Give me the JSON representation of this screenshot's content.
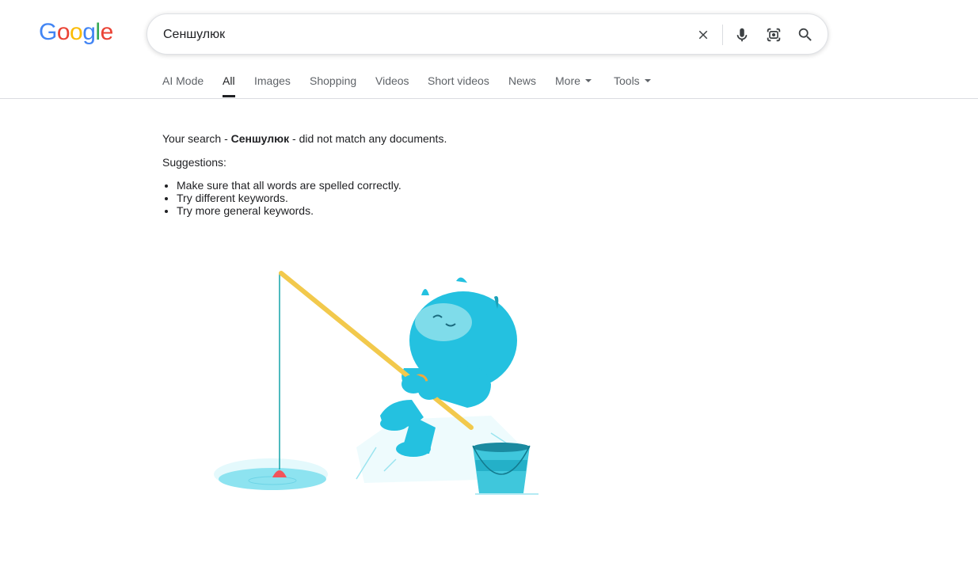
{
  "logo": {
    "letters": [
      "G",
      "o",
      "o",
      "g",
      "l",
      "e"
    ],
    "colors": [
      "#4285F4",
      "#EA4335",
      "#FBBC05",
      "#4285F4",
      "#34A853",
      "#EA4335"
    ]
  },
  "search": {
    "value": "Сеншулюк"
  },
  "icons": {
    "clear": "close-icon",
    "voice": "microphone-icon",
    "lens": "camera-lens-icon",
    "search": "search-icon"
  },
  "tabs": [
    {
      "label": "AI Mode"
    },
    {
      "label": "All",
      "active": true
    },
    {
      "label": "Images"
    },
    {
      "label": "Shopping"
    },
    {
      "label": "Videos"
    },
    {
      "label": "Short videos"
    },
    {
      "label": "News"
    },
    {
      "label": "More"
    },
    {
      "label": "Tools"
    }
  ],
  "results": {
    "prefix": "Your search - ",
    "query": "Сеншулюк",
    "suffix": " - did not match any documents.",
    "suggestions_title": "Suggestions:",
    "suggestions": [
      "Make sure that all words are spelled correctly.",
      "Try different keywords.",
      "Try more general keywords."
    ]
  },
  "colors": {
    "accent": "#202124",
    "muted": "#5f6368",
    "yeti": "#24C1E0"
  }
}
